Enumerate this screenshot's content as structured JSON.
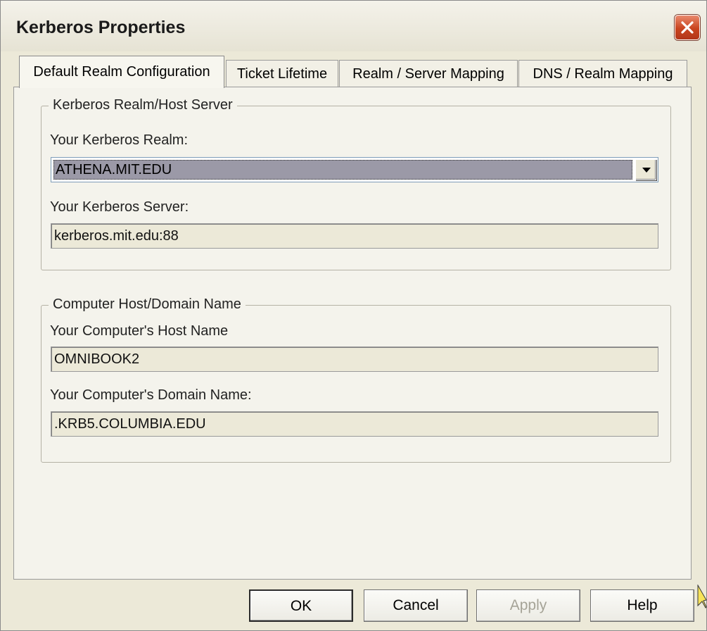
{
  "window": {
    "title": "Kerberos Properties"
  },
  "tabs": [
    {
      "label": "Default Realm Configuration",
      "active": true
    },
    {
      "label": "Ticket Lifetime",
      "active": false
    },
    {
      "label": "Realm / Server Mapping",
      "active": false
    },
    {
      "label": "DNS / Realm Mapping",
      "active": false
    }
  ],
  "realm_group": {
    "legend": "Kerberos Realm/Host Server",
    "realm_label": "Your Kerberos Realm:",
    "realm_value": "ATHENA.MIT.EDU",
    "server_label": "Your Kerberos Server:",
    "server_value": "kerberos.mit.edu:88"
  },
  "host_group": {
    "legend": "Computer Host/Domain Name",
    "host_label": "Your Computer's Host Name",
    "host_value": "OMNIBOOK2",
    "domain_label": "Your Computer's Domain Name:",
    "domain_value": ".KRB5.COLUMBIA.EDU"
  },
  "buttons": {
    "ok": "OK",
    "cancel": "Cancel",
    "apply": "Apply",
    "help": "Help"
  },
  "icons": {
    "close": "close-icon",
    "dropdown": "chevron-down-icon",
    "cursor": "mouse-pointer-icon"
  }
}
